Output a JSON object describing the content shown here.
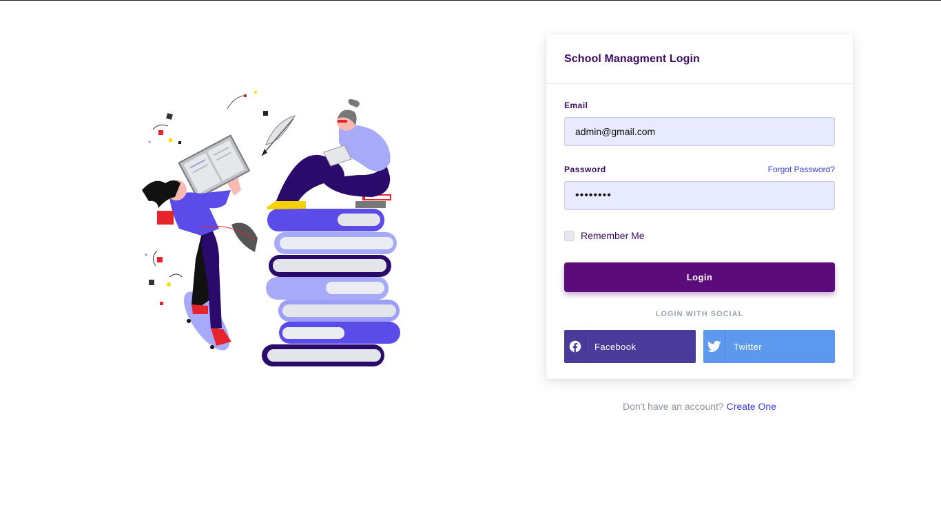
{
  "login_card": {
    "title": "School Managment Login",
    "email_label": "Email",
    "email_value": "admin@gmail.com",
    "password_label": "Password",
    "forgot_password": "Forgot Password?",
    "password_value": "secret12",
    "remember_me": "Remember Me",
    "remember_checked": false,
    "login_button": "Login",
    "social_heading": "LOGIN WITH SOCIAL",
    "facebook_label": "Facebook",
    "facebook_icon": "facebook-icon",
    "twitter_label": "Twitter",
    "twitter_icon": "twitter-icon"
  },
  "signup": {
    "prompt": "Don't have an account?",
    "link": "Create One"
  },
  "colors": {
    "primary": "#5c0c7a",
    "heading": "#3b0a62",
    "link": "#3a3ae0",
    "input_bg": "#e8ebfd",
    "facebook": "#4a3a9a",
    "twitter": "#5c98ee",
    "illustration_blue": "#5b4be8",
    "illustration_navy": "#2a0a6a"
  }
}
